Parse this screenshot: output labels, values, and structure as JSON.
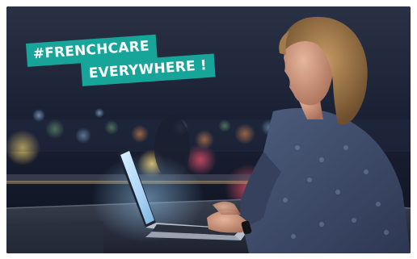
{
  "banner": {
    "line1": "#FRENCHCARE",
    "line2": "EVERYWHERE !"
  },
  "colors": {
    "accent": "#17a59a",
    "night_sky": "#141b2d"
  },
  "photo": {
    "icon": "woman-with-laptop-photo"
  }
}
